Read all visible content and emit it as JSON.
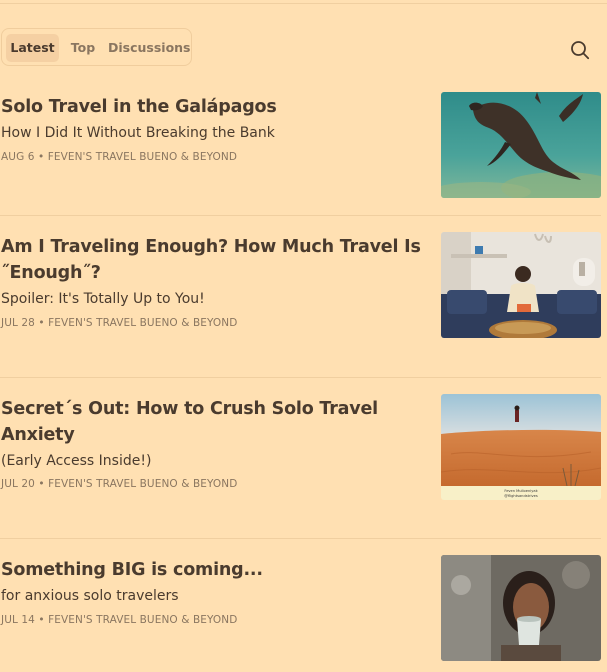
{
  "tabs": {
    "latest": "Latest",
    "top": "Top",
    "discussions": "Discussions"
  },
  "posts": [
    {
      "title": "Solo Travel in the Galápagos",
      "subtitle": "How I Did It Without Breaking the Bank",
      "meta": "AUG 6 • FEVEN'S TRAVEL BUENO & BEYOND",
      "image": "sea-lion-underwater"
    },
    {
      "title": "Am I Traveling Enough? How Much Travel Is ˝Enough˝?",
      "subtitle": "Spoiler: It's Totally Up to You!",
      "meta": "JUL 28 • FEVEN'S TRAVEL BUENO & BEYOND",
      "image": "woman-reading-on-couch"
    },
    {
      "title": "Secret´s Out: How to Crush Solo Travel Anxiety",
      "subtitle": "(Early Access Inside!)",
      "meta": "JUL 20 • FEVEN'S TRAVEL BUENO & BEYOND",
      "image": "desert-dunes",
      "image_caption": "Feven Mulloeniyak @flightsandstrives"
    },
    {
      "title": "Something BIG is coming...",
      "subtitle": "for anxious solo travelers",
      "meta": "JUL 14 • FEVEN'S TRAVEL BUENO & BEYOND",
      "image": "woman-drinking-coffee"
    }
  ],
  "colors": {
    "background": "#ffe0b2",
    "title": "#4a3b2e",
    "meta": "#8a7660"
  }
}
